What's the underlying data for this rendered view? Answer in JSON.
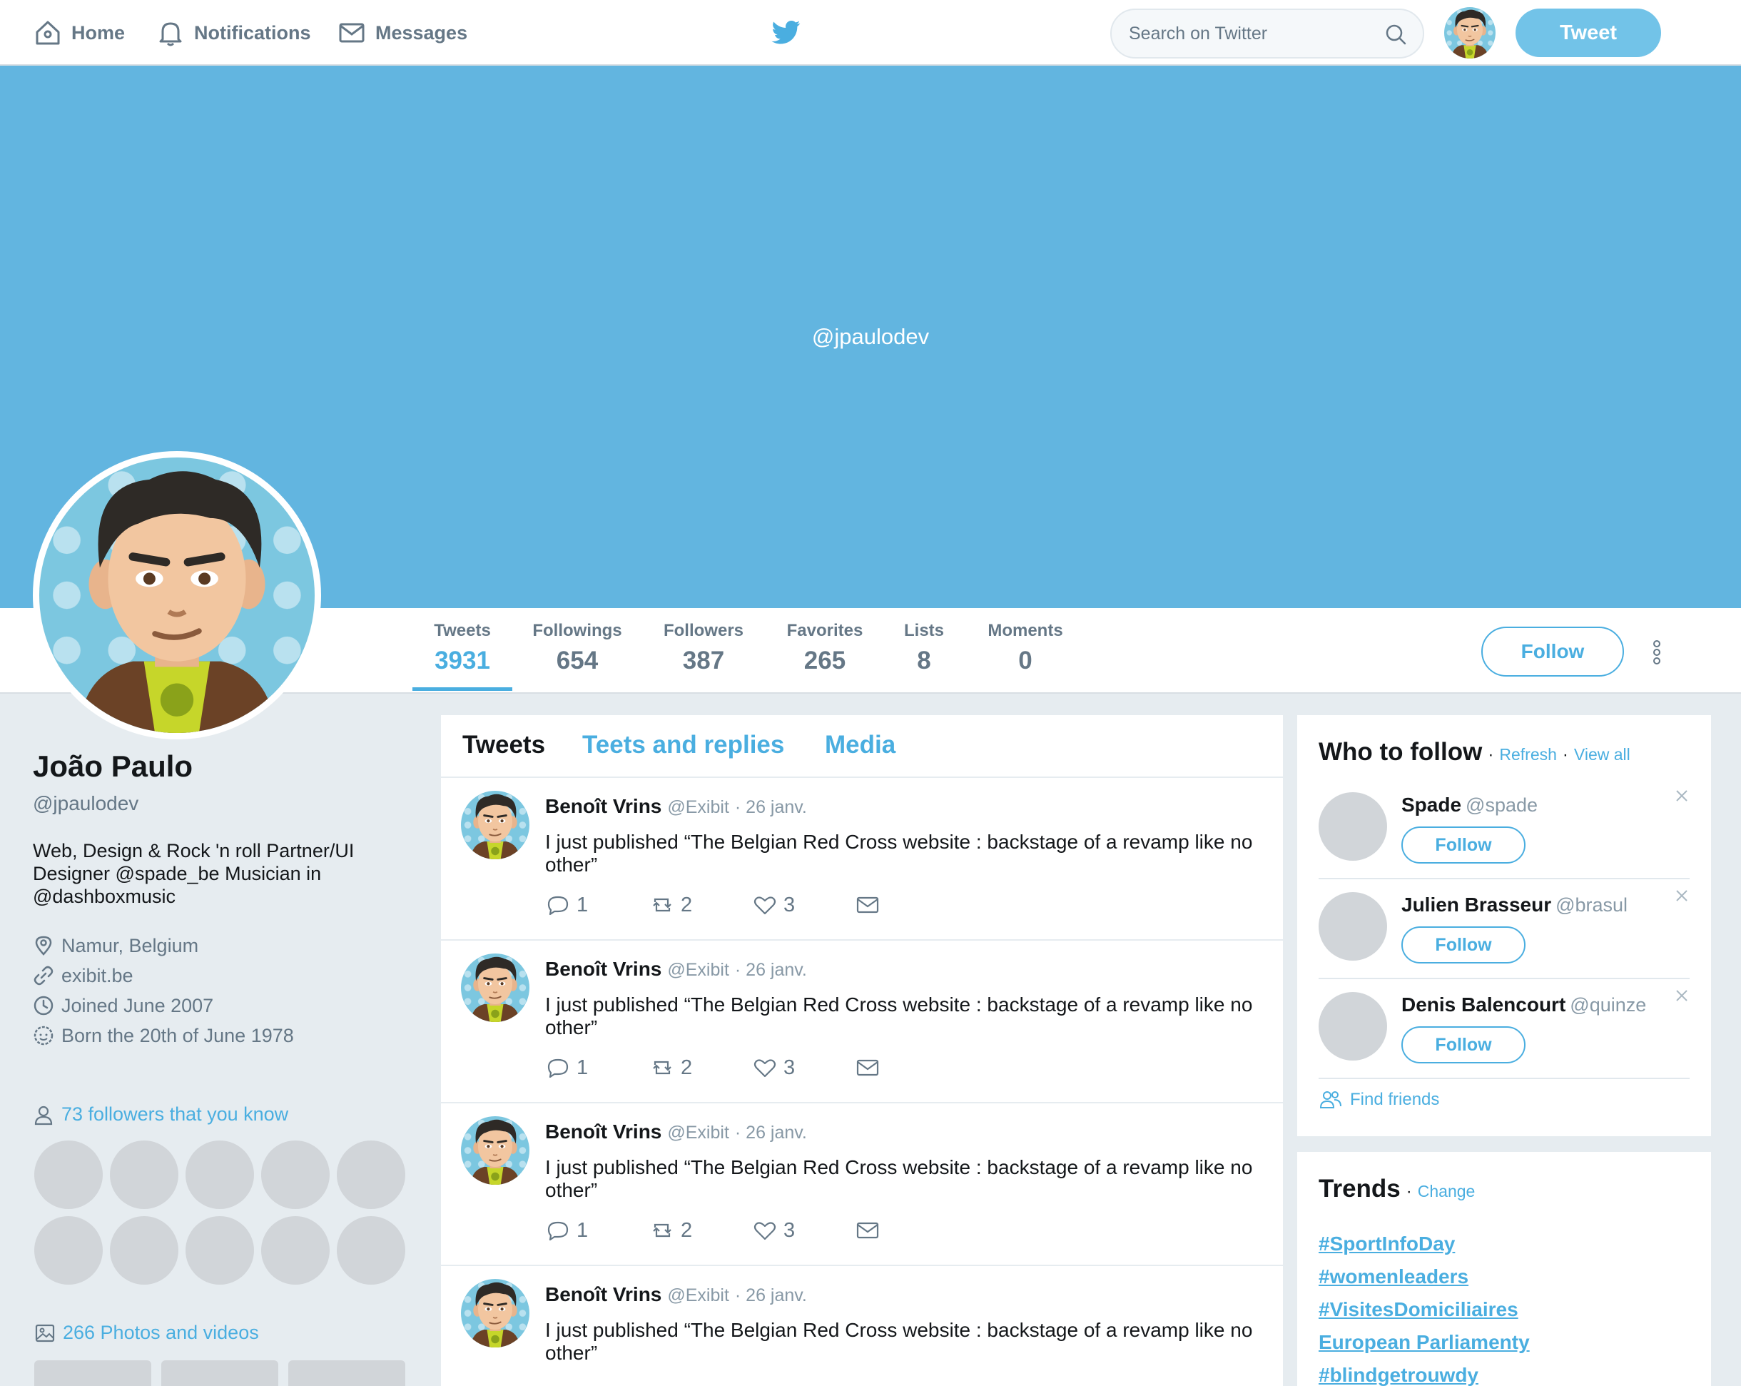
{
  "nav": {
    "home": "Home",
    "notifications": "Notifications",
    "messages": "Messages"
  },
  "search": {
    "placeholder": "Search on Twitter"
  },
  "tweet_button": "Tweet",
  "banner": {
    "handle": "@jpaulodev"
  },
  "stats": [
    {
      "label": "Tweets",
      "value": "3931"
    },
    {
      "label": "Followings",
      "value": "654"
    },
    {
      "label": "Followers",
      "value": "387"
    },
    {
      "label": "Favorites",
      "value": "265"
    },
    {
      "label": "Lists",
      "value": "8"
    },
    {
      "label": "Moments",
      "value": "0"
    }
  ],
  "follow_button": "Follow",
  "profile": {
    "name": "João Paulo",
    "handle": "@jpaulodev",
    "bio": "Web, Design & Rock 'n roll Partner/UI Designer @spade_be Musician in @dashboxmusic",
    "location": "Namur, Belgium",
    "website": "exibit.be",
    "joined": "Joined June 2007",
    "born": "Born the 20th of June 1978",
    "followers_known": "73 followers that you know",
    "photos": "266 Photos and videos"
  },
  "tabs": {
    "tweets": "Tweets",
    "replies": "Teets and replies",
    "media": "Media"
  },
  "tweets": [
    {
      "name": "Benoît Vrins",
      "handle": "@Exibit",
      "date": "· 26 janv.",
      "text": "I just published “The Belgian Red Cross website : backstage of a revamp like no other”",
      "replies": "1",
      "retweets": "2",
      "likes": "3"
    },
    {
      "name": "Benoît Vrins",
      "handle": "@Exibit",
      "date": "· 26 janv.",
      "text": "I just published “The Belgian Red Cross website : backstage of a revamp like no other”",
      "replies": "1",
      "retweets": "2",
      "likes": "3"
    },
    {
      "name": "Benoît Vrins",
      "handle": "@Exibit",
      "date": "· 26 janv.",
      "text": "I just published “The Belgian Red Cross website : backstage of a revamp like no other”",
      "replies": "1",
      "retweets": "2",
      "likes": "3"
    },
    {
      "name": "Benoît Vrins",
      "handle": "@Exibit",
      "date": "· 26 janv.",
      "text": "I just published “The Belgian Red Cross website : backstage of a revamp like no other”"
    }
  ],
  "who_to_follow": {
    "title": "Who to follow",
    "sep": "·",
    "refresh": "Refresh",
    "view_all": "View all",
    "follow_label": "Follow",
    "suggestions": [
      {
        "name": "Spade",
        "handle": "@spade"
      },
      {
        "name": "Julien Brasseur",
        "handle": "@brasul"
      },
      {
        "name": "Denis Balencourt",
        "handle": "@quinze"
      }
    ],
    "find_friends": "Find friends"
  },
  "trends": {
    "title": "Trends",
    "sep": "·",
    "change": "Change",
    "items": [
      "#SportInfoDay",
      "#womenleaders",
      "#VisitesDomiciliaires",
      "European Parliamenty",
      "#blindgetrouwdy"
    ]
  },
  "colors": {
    "accent": "#4aaee0",
    "banner": "#62b5e0",
    "tweet_button": "#72c3e8",
    "background": "#e6ecf0",
    "placeholder_avatar": "#d1d5d9"
  },
  "icons": {
    "home": "home-icon",
    "notifications": "bell-icon",
    "messages": "envelope-icon",
    "logo": "twitter-bird-icon",
    "search": "search-icon",
    "location": "location-pin-icon",
    "website": "link-icon",
    "joined": "clock-icon",
    "born": "birthday-icon",
    "followers": "person-icon",
    "photos": "image-icon",
    "reply": "reply-icon",
    "retweet": "retweet-icon",
    "like": "heart-icon",
    "dm": "envelope-icon",
    "find_friends": "people-icon",
    "more": "vertical-dots-icon"
  }
}
